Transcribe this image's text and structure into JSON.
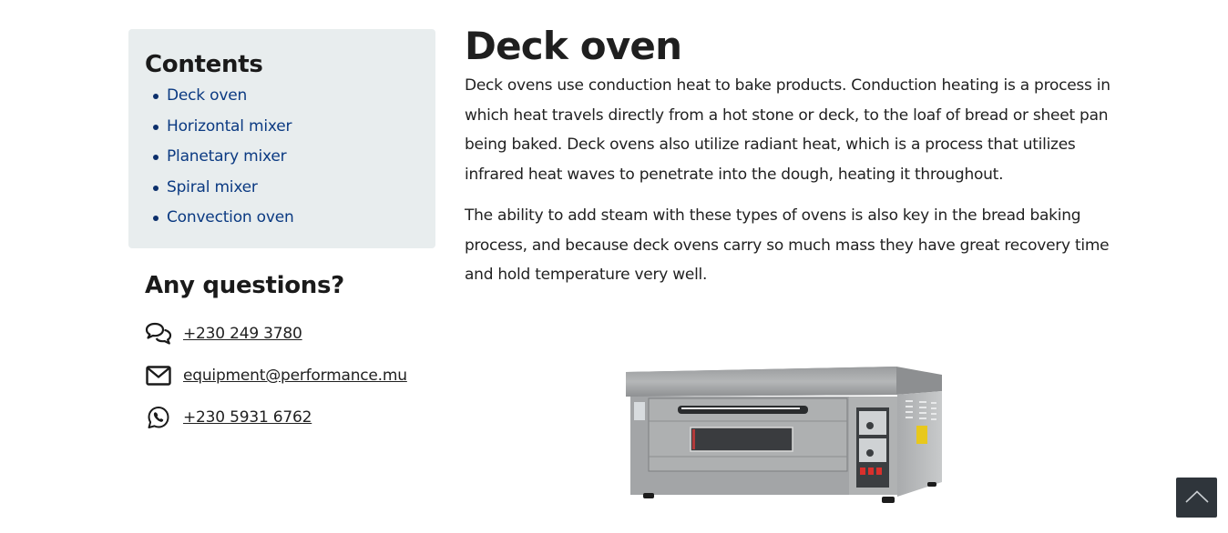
{
  "toc": {
    "title": "Contents",
    "items": [
      {
        "label": "Deck oven"
      },
      {
        "label": "Horizontal mixer"
      },
      {
        "label": "Planetary mixer"
      },
      {
        "label": "Spiral mixer"
      },
      {
        "label": "Convection oven"
      }
    ]
  },
  "questions": {
    "title": "Any questions?",
    "contacts": [
      {
        "icon": "chat-bubbles-icon",
        "label": "+230 249 3780"
      },
      {
        "icon": "envelope-icon",
        "label": "equipment@performance.mu"
      },
      {
        "icon": "whatsapp-icon",
        "label": "+230 5931 6762"
      }
    ]
  },
  "article": {
    "title": "Deck oven",
    "paragraphs": [
      "Deck ovens use conduction heat to bake products. Conduction heating is a process in which heat travels directly from a hot stone or deck, to the loaf of bread or sheet pan being baked. Deck ovens also utilize radiant heat, which is a process that utilizes infrared heat waves to penetrate into the dough, heating it throughout.",
      "The ability to add steam with these types of ovens is also key in the bread baking process, and because deck ovens carry so much mass they have great recovery time and hold temperature very well."
    ],
    "image_alt": "Stainless steel single deck oven"
  },
  "back_to_top": {
    "icon": "chevron-up-icon"
  }
}
